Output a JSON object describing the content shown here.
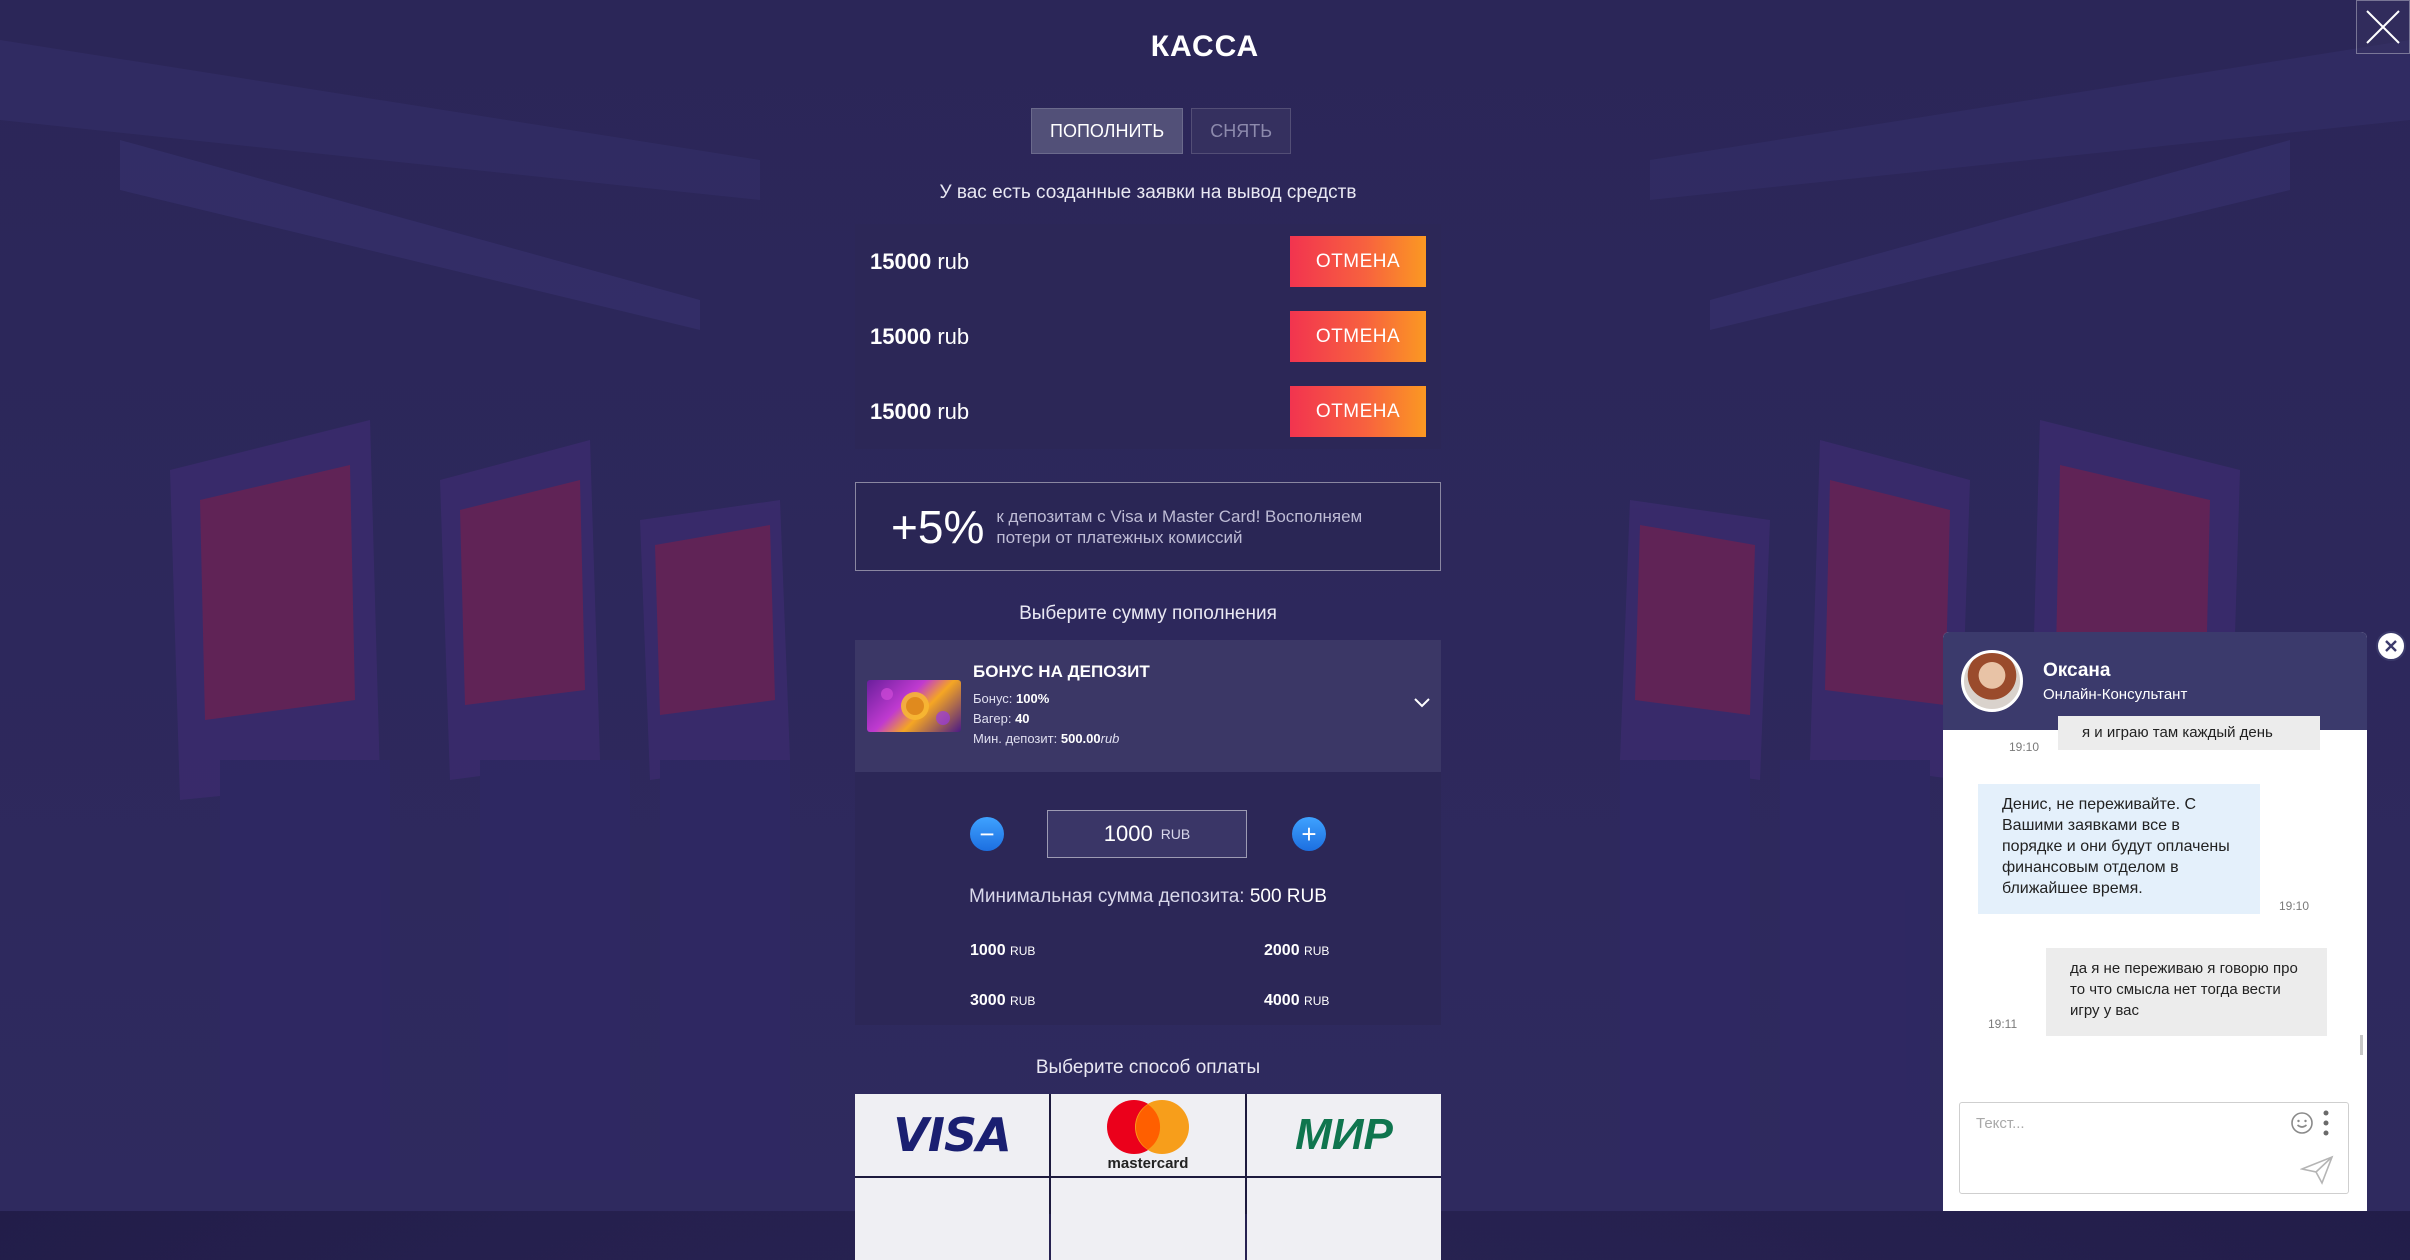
{
  "header": {
    "title": "КАССА"
  },
  "tabs": [
    {
      "label": "ПОПОЛНИТЬ",
      "active": true
    },
    {
      "label": "СНЯТЬ",
      "active": false
    }
  ],
  "withdrawals": {
    "notice": "У вас есть созданные заявки на вывод средств",
    "items": [
      {
        "amount": "15000",
        "currency": "rub",
        "action": "ОТМЕНА"
      },
      {
        "amount": "15000",
        "currency": "rub",
        "action": "ОТМЕНА"
      },
      {
        "amount": "15000",
        "currency": "rub",
        "action": "ОТМЕНА"
      }
    ]
  },
  "promo": {
    "big": "+5%",
    "text": "к депозитам с Visa и Master Card! Восполняем потери от платежных комиссий"
  },
  "deposit": {
    "choose_label": "Выберите сумму пополнения",
    "bonus": {
      "title": "БОНУС НА ДЕПОЗИТ",
      "bonus_label": "Бонус:",
      "bonus_value": "100%",
      "wager_label": "Вагер:",
      "wager_value": "40",
      "min_label": "Мин. депозит:",
      "min_value": "500.00",
      "min_currency": "rub"
    },
    "minus": "−",
    "plus": "+",
    "amount": "1000",
    "amount_currency": "RUB",
    "min_text": "Минимальная сумма депозита:",
    "min_value": "500 RUB",
    "presets": [
      {
        "value": "1000",
        "currency": "RUB"
      },
      {
        "value": "2000",
        "currency": "RUB"
      },
      {
        "value": "3000",
        "currency": "RUB"
      },
      {
        "value": "4000",
        "currency": "RUB"
      }
    ]
  },
  "payment": {
    "choose_label": "Выберите способ оплаты",
    "methods": [
      {
        "name": "VISA"
      },
      {
        "name": "mastercard"
      },
      {
        "name": "МИР"
      }
    ]
  },
  "chat": {
    "agent_name": "Оксана",
    "agent_role": "Онлайн-Консультант",
    "messages": [
      {
        "direction": "out",
        "text": "я и играю там каждый день",
        "time": "19:10"
      },
      {
        "direction": "in",
        "text": "Денис, не переживайте. С Вашими заявками все в порядке и они будут оплачены финансовым отделом в ближайшее время.",
        "time": "19:10"
      },
      {
        "direction": "out",
        "text": "да я не переживаю я говорю про то что смысла нет тогда вести игру у вас",
        "time": "19:11"
      }
    ],
    "input_placeholder": "Текст..."
  },
  "colors": {
    "background": "#2a2556",
    "cancel_gradient_start": "#f2344f",
    "cancel_gradient_end": "#fb9922",
    "stepper_blue": "#2f8cf5",
    "chat_header": "#3b3a6c"
  }
}
